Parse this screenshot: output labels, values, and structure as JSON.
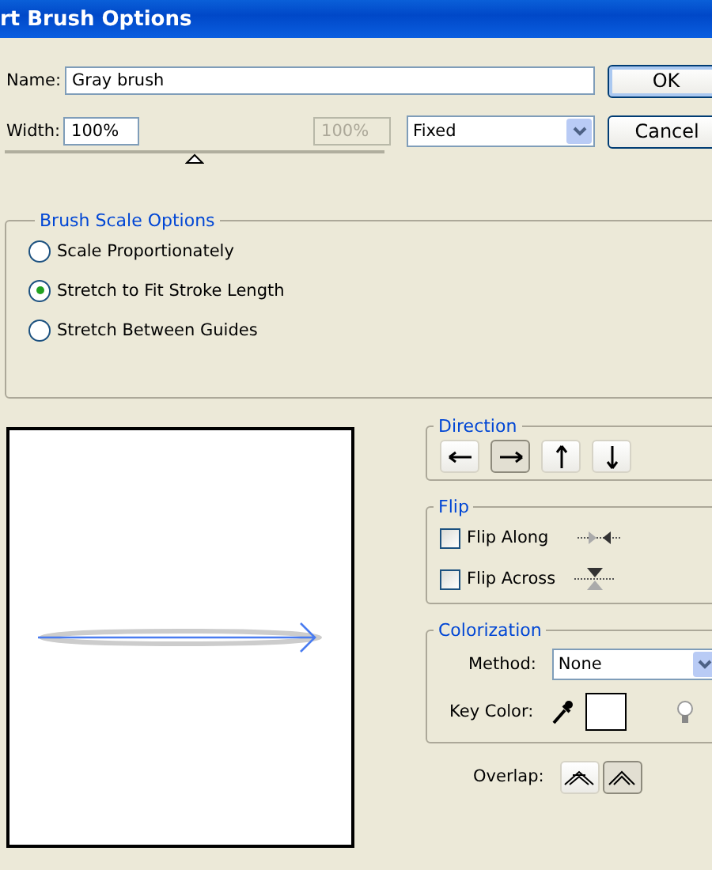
{
  "window": {
    "title": "rt Brush Options"
  },
  "name_field": {
    "label": "Name:",
    "value": "Gray brush"
  },
  "width_field": {
    "label": "Width:",
    "value": "100%",
    "variation_value": "100%",
    "variation_disabled": true,
    "mode": "Fixed",
    "slider": {
      "level": 0.5
    }
  },
  "buttons": [
    {
      "label": "OK",
      "default": true
    },
    {
      "label": "Cancel",
      "default": false
    }
  ],
  "brush_scale_options": {
    "title": "Brush Scale Options",
    "options": [
      {
        "label": "Scale Proportionately",
        "selected": false
      },
      {
        "label": "Stretch to Fit Stroke Length",
        "selected": true
      },
      {
        "label": "Stretch Between Guides",
        "selected": false
      }
    ]
  },
  "preview": {
    "kind": "arrow-stroke"
  },
  "direction": {
    "title": "Direction",
    "buttons": [
      {
        "kind": "left",
        "selected": false
      },
      {
        "kind": "right",
        "selected": true
      },
      {
        "kind": "up",
        "selected": false
      },
      {
        "kind": "down",
        "selected": false
      }
    ]
  },
  "flip": {
    "title": "Flip",
    "options": [
      {
        "label": "Flip Along",
        "kind": "along",
        "checked": false
      },
      {
        "label": "Flip Across",
        "kind": "across",
        "checked": false
      }
    ]
  },
  "colorization": {
    "title": "Colorization",
    "method_label": "Method:",
    "method": "None",
    "key_color_label": "Key Color:"
  },
  "overlap": {
    "label": "Overlap:",
    "buttons": [
      {
        "kind": "adjust",
        "selected": false
      },
      {
        "kind": "plain",
        "selected": true
      }
    ]
  }
}
